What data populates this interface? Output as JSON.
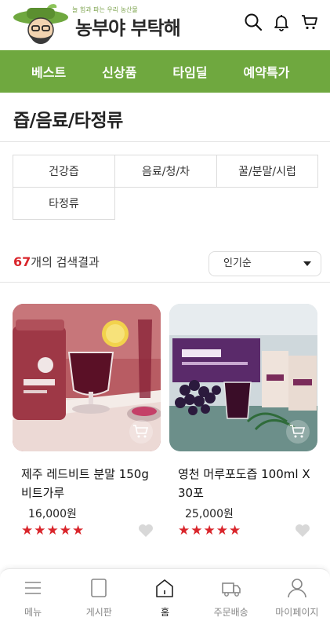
{
  "header": {
    "logo_tagline": "늘 힘과 파는 우리 농산물",
    "logo_name": "농부야 부탁해",
    "icons": [
      "search-icon",
      "bell-icon",
      "cart-icon"
    ]
  },
  "category_nav": {
    "items": [
      "베스트",
      "신상품",
      "타임딜",
      "예약특가"
    ],
    "background": "#6fa83f"
  },
  "page_title": "즙/음료/타정류",
  "subcategories": [
    "건강즙",
    "음료/청/차",
    "꿀/분말/시럽",
    "타정류"
  ],
  "results": {
    "count": "67",
    "suffix": "개의 검색결과",
    "sort_selected": "인기순"
  },
  "products": [
    {
      "name": "제주 레드비트 분말 150g 비트가루",
      "price": "16,000원",
      "rating": 5,
      "stars": "★★★★★"
    },
    {
      "name": "영천 머루포도즙 100ml X 30포",
      "price": "25,000원",
      "rating": 5,
      "stars": "★★★★★"
    }
  ],
  "bottom_nav": {
    "items": [
      {
        "label": "메뉴",
        "icon": "menu-icon"
      },
      {
        "label": "게시판",
        "icon": "board-icon"
      },
      {
        "label": "홈",
        "icon": "home-icon"
      },
      {
        "label": "주문배송",
        "icon": "delivery-truck-icon"
      },
      {
        "label": "마이페이지",
        "icon": "user-icon"
      }
    ],
    "active": "홈"
  },
  "colors": {
    "accent_green": "#6fa83f",
    "accent_red": "#d9252b"
  }
}
